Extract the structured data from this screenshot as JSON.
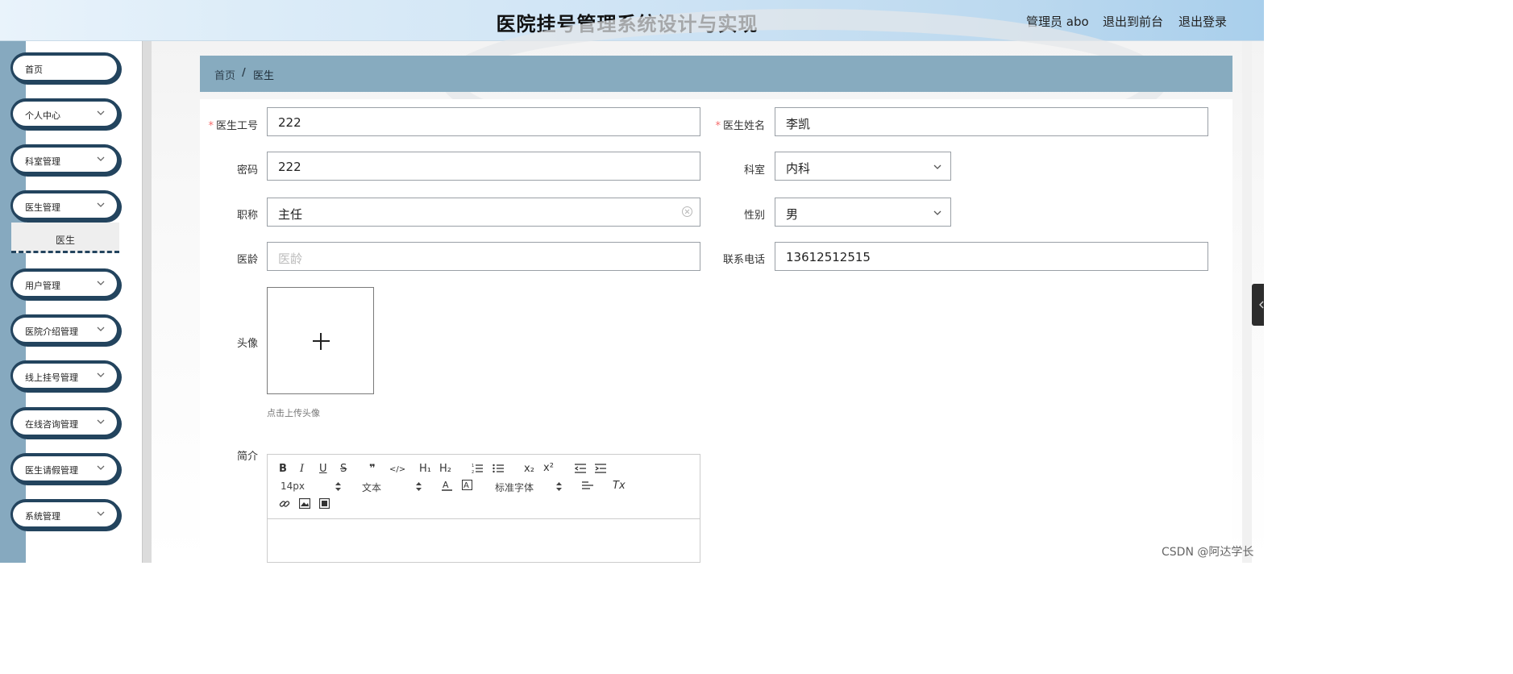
{
  "header": {
    "title": "医院挂号管理系统设计与实现",
    "admin": "管理员 abo",
    "back_front": "退出到前台",
    "logout": "退出登录"
  },
  "sidebar": {
    "items": [
      {
        "label": "首页"
      },
      {
        "label": "个人中心"
      },
      {
        "label": "科室管理"
      },
      {
        "label": "医生管理"
      },
      {
        "label": "用户管理"
      },
      {
        "label": "医院介绍管理"
      },
      {
        "label": "线上挂号管理"
      },
      {
        "label": "在线咨询管理"
      },
      {
        "label": "医生请假管理"
      },
      {
        "label": "系统管理"
      }
    ],
    "sub_item": "医生"
  },
  "breadcrumb": {
    "home": "首页",
    "sep": "/",
    "current": "医生"
  },
  "form": {
    "doctor_id": {
      "label": "医生工号",
      "value": "222"
    },
    "doctor_name": {
      "label": "医生姓名",
      "value": "李凯"
    },
    "password": {
      "label": "密码",
      "value": "222"
    },
    "department": {
      "label": "科室",
      "value": "内科"
    },
    "title": {
      "label": "职称",
      "value": "主任"
    },
    "gender": {
      "label": "性别",
      "value": "男"
    },
    "years": {
      "label": "医龄",
      "placeholder": "医龄"
    },
    "phone": {
      "label": "联系电话",
      "value": "13612512515"
    },
    "avatar": {
      "label": "头像",
      "tip": "点击上传头像"
    },
    "intro": {
      "label": "简介"
    }
  },
  "editor": {
    "font_size": "14px",
    "header_select": "文本",
    "font_family": "标准字体",
    "buttons": {
      "bold": "B",
      "italic": "I",
      "underline": "U",
      "strike": "S",
      "quote": "❞",
      "code": "</>",
      "h1": "H₁",
      "h2": "H₂",
      "sub": "x₂",
      "sup": "x²",
      "clean": "Tx"
    }
  },
  "watermark": "CSDN @阿达学长"
}
